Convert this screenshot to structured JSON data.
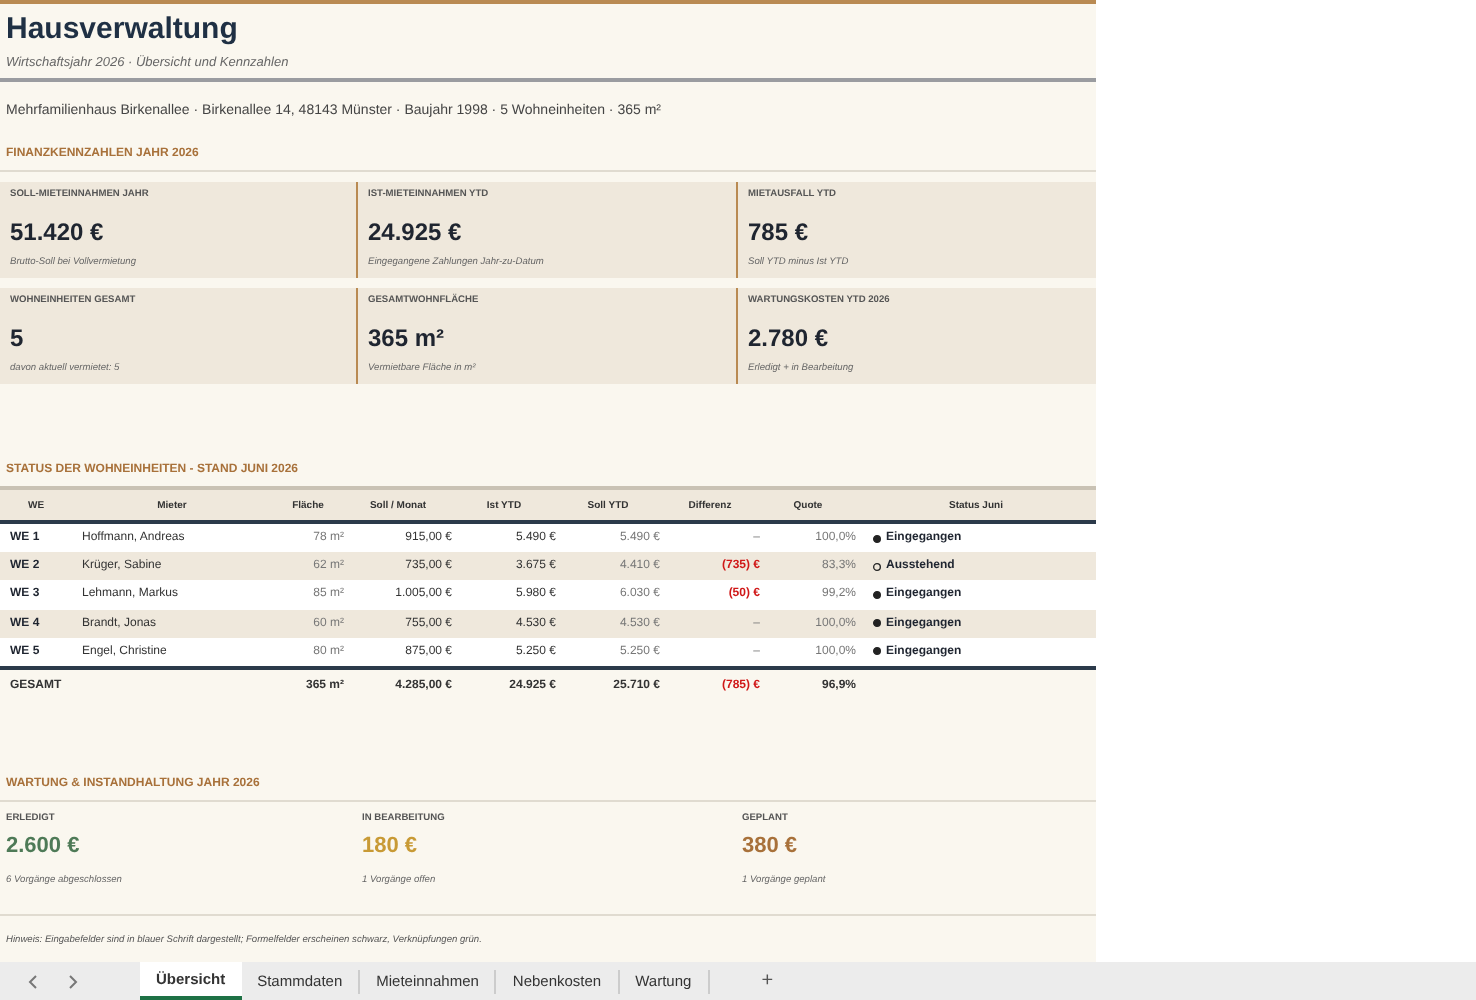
{
  "title": "Hausverwaltung",
  "subtitle": "Wirtschaftsjahr 2026 · Übersicht und Kennzahlen",
  "property_line": "Mehrfamilienhaus Birkenallee  ·  Birkenallee 14, 48143 Münster  ·  Baujahr 1998  ·  5 Wohneinheiten  ·  365 m²",
  "finance_heading": "FINANZKENNZAHLEN JAHR 2026",
  "kpi_cards": [
    {
      "label": "SOLL-MIETEINNAHMEN JAHR",
      "value": "51.420 €",
      "note": "Brutto-Soll bei Vollvermietung"
    },
    {
      "label": "IST-MIETEINNAHMEN YTD",
      "value": "24.925 €",
      "note": "Eingegangene Zahlungen Jahr-zu-Datum"
    },
    {
      "label": "MIETAUSFALL YTD",
      "value": "785 €",
      "note": "Soll YTD minus Ist YTD"
    },
    {
      "label": "WOHNEINHEITEN GESAMT",
      "value": "5",
      "note": "davon aktuell vermietet: 5"
    },
    {
      "label": "GESAMTWOHNFLÄCHE",
      "value": "365 m²",
      "note": "Vermietbare Fläche in m²"
    },
    {
      "label": "WARTUNGSKOSTEN YTD 2026",
      "value": "2.780 €",
      "note": "Erledigt + in Bearbeitung"
    }
  ],
  "units_heading": "STATUS DER WOHNEINHEITEN - STAND JUNI 2026",
  "table": {
    "columns": [
      "WE",
      "Mieter",
      "Fläche",
      "Soll / Monat",
      "Ist YTD",
      "Soll YTD",
      "Differenz",
      "Quote",
      "Status Juni"
    ],
    "rows": [
      {
        "we": "WE 1",
        "tenant": "Hoffmann, Andreas",
        "area": "78 m²",
        "monthly": "915,00 €",
        "ist": "5.490 €",
        "soll": "5.490 €",
        "diff": "–",
        "negative": false,
        "quote": "100,0%",
        "paid": true,
        "status": "Eingegangen"
      },
      {
        "we": "WE 2",
        "tenant": "Krüger, Sabine",
        "area": "62 m²",
        "monthly": "735,00 €",
        "ist": "3.675 €",
        "soll": "4.410 €",
        "diff": "(735) €",
        "negative": true,
        "quote": "83,3%",
        "paid": false,
        "status": "Ausstehend"
      },
      {
        "we": "WE 3",
        "tenant": "Lehmann, Markus",
        "area": "85 m²",
        "monthly": "1.005,00 €",
        "ist": "5.980 €",
        "soll": "6.030 €",
        "diff": "(50) €",
        "negative": true,
        "quote": "99,2%",
        "paid": true,
        "status": "Eingegangen"
      },
      {
        "we": "WE 4",
        "tenant": "Brandt, Jonas",
        "area": "60 m²",
        "monthly": "755,00 €",
        "ist": "4.530 €",
        "soll": "4.530 €",
        "diff": "–",
        "negative": false,
        "quote": "100,0%",
        "paid": true,
        "status": "Eingegangen"
      },
      {
        "we": "WE 5",
        "tenant": "Engel, Christine",
        "area": "80 m²",
        "monthly": "875,00 €",
        "ist": "5.250 €",
        "soll": "5.250 €",
        "diff": "–",
        "negative": false,
        "quote": "100,0%",
        "paid": true,
        "status": "Eingegangen"
      }
    ],
    "total": {
      "label": "GESAMT",
      "area": "365 m²",
      "monthly": "4.285,00 €",
      "ist": "24.925 €",
      "soll": "25.710 €",
      "diff": "(785) €",
      "negative": true,
      "quote": "96,9%"
    }
  },
  "maintenance_heading": "WARTUNG & INSTANDHALTUNG JAHR 2026",
  "maintenance": [
    {
      "label": "ERLEDIGT",
      "value": "2.600 €",
      "note": "6 Vorgänge abgeschlossen",
      "color": "#4e7a57"
    },
    {
      "label": "IN BEARBEITUNG",
      "value": "180 €",
      "note": "1 Vorgänge offen",
      "color": "#c89a35"
    },
    {
      "label": "GEPLANT",
      "value": "380 €",
      "note": "1 Vorgänge geplant",
      "color": "#a8713a"
    }
  ],
  "hint": "Hinweis: Eingabefelder sind in blauer Schrift dargestellt; Formelfelder erscheinen schwarz, Verknüpfungen grün.",
  "sheet_tabs": [
    {
      "label": "Übersicht",
      "selected": true
    },
    {
      "label": "Stammdaten",
      "selected": false
    },
    {
      "label": "Mieteinnahmen",
      "selected": false
    },
    {
      "label": "Nebenkosten",
      "selected": false
    },
    {
      "label": "Wartung",
      "selected": false
    }
  ],
  "add_sheet": "+"
}
